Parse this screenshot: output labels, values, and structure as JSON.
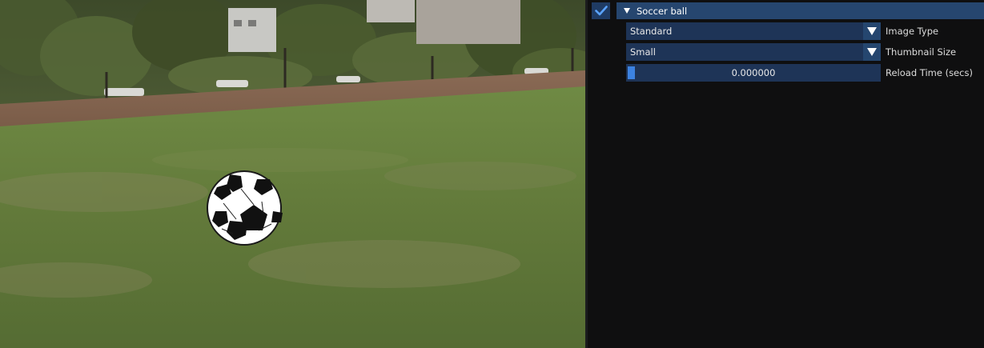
{
  "scene": {
    "object": "Soccer ball"
  },
  "panel": {
    "node": {
      "visible": true,
      "title": "Soccer ball",
      "expanded": true
    },
    "properties": [
      {
        "type": "combo",
        "value": "Standard",
        "label": "Image Type"
      },
      {
        "type": "combo",
        "value": "Small",
        "label": "Thumbnail Size"
      },
      {
        "type": "slider",
        "value": "0.000000",
        "label": "Reload Time (secs)"
      }
    ]
  },
  "colors": {
    "panel_bg": "#0f0f10",
    "header_bg": "#26466f",
    "field_bg": "#1e3457",
    "accent": "#3c82e0",
    "grass": "#5f7a3a"
  }
}
